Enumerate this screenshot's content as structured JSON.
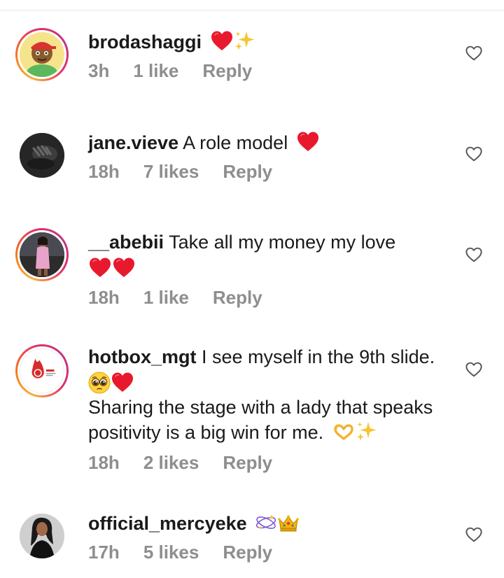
{
  "comments": [
    {
      "username": "brodashaggi",
      "text": "",
      "emoji_line1": "red-heart-emoji sparkles-emoji",
      "time": "3h",
      "likes": "1 like",
      "reply": "Reply"
    },
    {
      "username": "jane.vieve",
      "text": "A role model",
      "time": "18h",
      "likes": "7 likes",
      "reply": "Reply"
    },
    {
      "username": "__abebii",
      "text": "Take all my money my love",
      "time": "18h",
      "likes": "1 like",
      "reply": "Reply"
    },
    {
      "username": "hotbox_mgt",
      "text": "I see myself in the 9th slide.",
      "text2": "Sharing the stage with a lady that speaks positivity is a big win for me.",
      "time": "18h",
      "likes": "2 likes",
      "reply": "Reply"
    },
    {
      "username": "official_mercyeke",
      "text": "",
      "time": "17h",
      "likes": "5 likes",
      "reply": "Reply"
    }
  ],
  "colors": {
    "heart": "#e8192c",
    "meta_text": "#8e8e8e",
    "story_ring_start": "#fbb03b",
    "story_ring_end": "#c13584"
  },
  "icons": {
    "like": "heart-outline-icon",
    "heart_emoji": "red-heart-emoji",
    "sparkles_emoji": "sparkles-emoji"
  }
}
